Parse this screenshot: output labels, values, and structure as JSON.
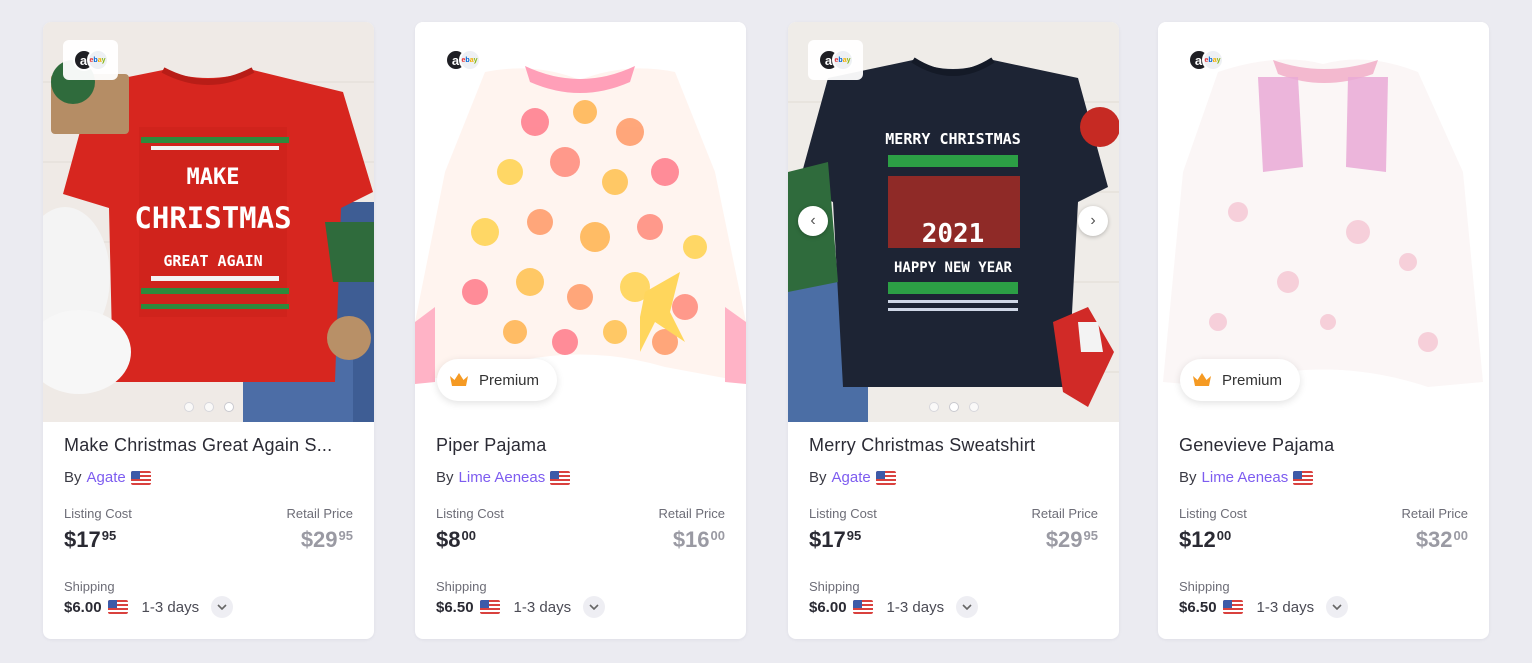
{
  "colors": {
    "accent": "#7d5cf0",
    "background": "#ebebf1",
    "card": "#ffffff",
    "retail_gray": "#9a9aa3"
  },
  "labels": {
    "listing_cost": "Listing Cost",
    "retail_price": "Retail Price",
    "shipping": "Shipping",
    "by": "By",
    "premium": "Premium"
  },
  "source_logo": {
    "amazon": "a",
    "ebay": [
      "e",
      "b",
      "a",
      "y"
    ]
  },
  "products": [
    {
      "title": "Make Christmas Great Again S...",
      "seller": "Agate",
      "listing_cost_whole": "$17",
      "listing_cost_cents": "95",
      "retail_whole": "$29",
      "retail_cents": "95",
      "shipping_cost": "$6.00",
      "delivery": "1-3 days",
      "premium": false,
      "graphic_lines": [
        "MAKE",
        "CHRISTMAS",
        "GREAT AGAIN"
      ]
    },
    {
      "title": "Piper Pajama",
      "seller": "Lime Aeneas",
      "listing_cost_whole": "$8",
      "listing_cost_cents": "00",
      "retail_whole": "$16",
      "retail_cents": "00",
      "shipping_cost": "$6.50",
      "delivery": "1-3 days",
      "premium": true
    },
    {
      "title": "Merry Christmas Sweatshirt",
      "seller": "Agate",
      "listing_cost_whole": "$17",
      "listing_cost_cents": "95",
      "retail_whole": "$29",
      "retail_cents": "95",
      "shipping_cost": "$6.00",
      "delivery": "1-3 days",
      "premium": false,
      "graphic_lines": [
        "MERRY CHRISTMAS",
        "2021",
        "HAPPY NEW YEAR"
      ]
    },
    {
      "title": "Genevieve Pajama",
      "seller": "Lime Aeneas",
      "listing_cost_whole": "$12",
      "listing_cost_cents": "00",
      "retail_whole": "$32",
      "retail_cents": "00",
      "shipping_cost": "$6.50",
      "delivery": "1-3 days",
      "premium": true
    }
  ]
}
